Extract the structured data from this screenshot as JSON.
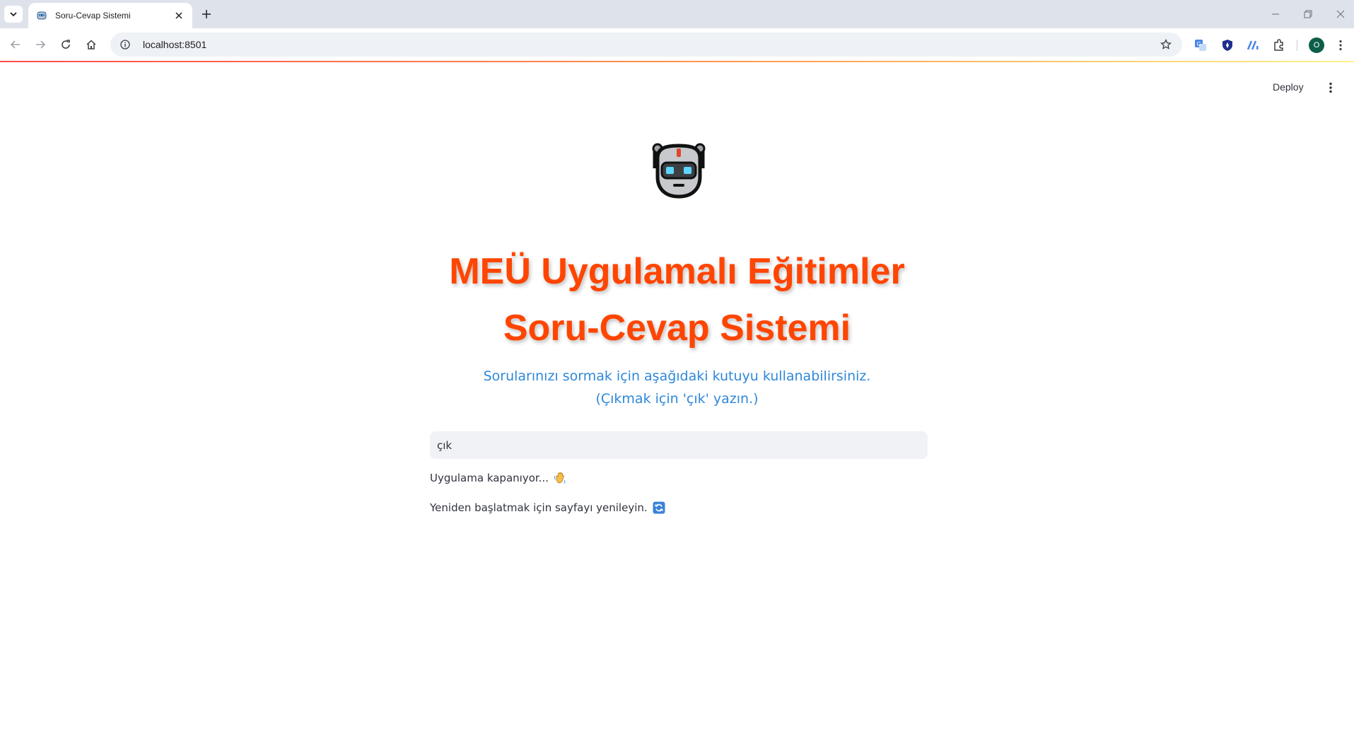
{
  "browser": {
    "tab_title": "Soru-Cevap Sistemi",
    "url": "localhost:8501",
    "profile_initial": "O",
    "icons": [
      "tab-list-icon",
      "close-icon",
      "plus-icon",
      "minimize-icon",
      "restore-icon",
      "close-window-icon",
      "back-icon",
      "forward-icon",
      "reload-icon",
      "home-icon",
      "site-info-icon",
      "star-icon",
      "translate-icon",
      "shield-icon",
      "analytics-icon",
      "extensions-icon",
      "kebab-menu-icon"
    ]
  },
  "header": {
    "deploy_label": "Deploy"
  },
  "main": {
    "logo_icon": "robot-icon",
    "title_line1": "MEÜ Uygulamalı Eğitimler",
    "title_line2": "Soru-Cevap Sistemi",
    "subtitle_line1": "Sorularınızı sormak için aşağıdaki kutuyu kullanabilirsiniz.",
    "subtitle_line2": "(Çıkmak için 'çık' yazın.)",
    "question_input_value": "çık",
    "message_closing": "Uygulama kapanıyor...",
    "message_closing_icon": "waving-hand-icon",
    "message_restart": "Yeniden başlatmak için sayfayı yenileyin.",
    "message_restart_icon": "refresh-icon"
  },
  "colors": {
    "title": "#ff4500",
    "subtitle": "#2f88d8",
    "input_bg": "#f0f2f6",
    "tabbar_bg": "#dee3eb"
  }
}
